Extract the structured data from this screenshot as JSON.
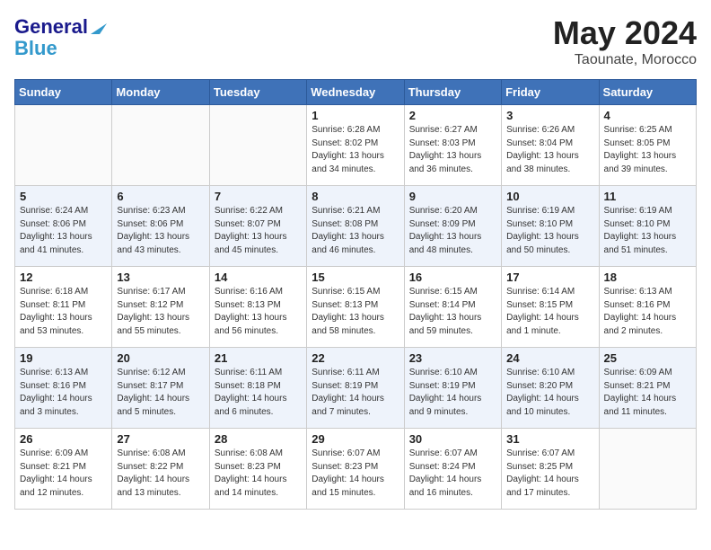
{
  "header": {
    "logo_line1": "General",
    "logo_line2": "Blue",
    "month": "May 2024",
    "location": "Taounate, Morocco"
  },
  "days_of_week": [
    "Sunday",
    "Monday",
    "Tuesday",
    "Wednesday",
    "Thursday",
    "Friday",
    "Saturday"
  ],
  "weeks": [
    [
      {
        "day": null
      },
      {
        "day": null
      },
      {
        "day": null
      },
      {
        "day": "1",
        "sunrise": "6:28 AM",
        "sunset": "8:02 PM",
        "daylight": "13 hours and 34 minutes."
      },
      {
        "day": "2",
        "sunrise": "6:27 AM",
        "sunset": "8:03 PM",
        "daylight": "13 hours and 36 minutes."
      },
      {
        "day": "3",
        "sunrise": "6:26 AM",
        "sunset": "8:04 PM",
        "daylight": "13 hours and 38 minutes."
      },
      {
        "day": "4",
        "sunrise": "6:25 AM",
        "sunset": "8:05 PM",
        "daylight": "13 hours and 39 minutes."
      }
    ],
    [
      {
        "day": "5",
        "sunrise": "6:24 AM",
        "sunset": "8:06 PM",
        "daylight": "13 hours and 41 minutes."
      },
      {
        "day": "6",
        "sunrise": "6:23 AM",
        "sunset": "8:06 PM",
        "daylight": "13 hours and 43 minutes."
      },
      {
        "day": "7",
        "sunrise": "6:22 AM",
        "sunset": "8:07 PM",
        "daylight": "13 hours and 45 minutes."
      },
      {
        "day": "8",
        "sunrise": "6:21 AM",
        "sunset": "8:08 PM",
        "daylight": "13 hours and 46 minutes."
      },
      {
        "day": "9",
        "sunrise": "6:20 AM",
        "sunset": "8:09 PM",
        "daylight": "13 hours and 48 minutes."
      },
      {
        "day": "10",
        "sunrise": "6:19 AM",
        "sunset": "8:10 PM",
        "daylight": "13 hours and 50 minutes."
      },
      {
        "day": "11",
        "sunrise": "6:19 AM",
        "sunset": "8:10 PM",
        "daylight": "13 hours and 51 minutes."
      }
    ],
    [
      {
        "day": "12",
        "sunrise": "6:18 AM",
        "sunset": "8:11 PM",
        "daylight": "13 hours and 53 minutes."
      },
      {
        "day": "13",
        "sunrise": "6:17 AM",
        "sunset": "8:12 PM",
        "daylight": "13 hours and 55 minutes."
      },
      {
        "day": "14",
        "sunrise": "6:16 AM",
        "sunset": "8:13 PM",
        "daylight": "13 hours and 56 minutes."
      },
      {
        "day": "15",
        "sunrise": "6:15 AM",
        "sunset": "8:13 PM",
        "daylight": "13 hours and 58 minutes."
      },
      {
        "day": "16",
        "sunrise": "6:15 AM",
        "sunset": "8:14 PM",
        "daylight": "13 hours and 59 minutes."
      },
      {
        "day": "17",
        "sunrise": "6:14 AM",
        "sunset": "8:15 PM",
        "daylight": "14 hours and 1 minute."
      },
      {
        "day": "18",
        "sunrise": "6:13 AM",
        "sunset": "8:16 PM",
        "daylight": "14 hours and 2 minutes."
      }
    ],
    [
      {
        "day": "19",
        "sunrise": "6:13 AM",
        "sunset": "8:16 PM",
        "daylight": "14 hours and 3 minutes."
      },
      {
        "day": "20",
        "sunrise": "6:12 AM",
        "sunset": "8:17 PM",
        "daylight": "14 hours and 5 minutes."
      },
      {
        "day": "21",
        "sunrise": "6:11 AM",
        "sunset": "8:18 PM",
        "daylight": "14 hours and 6 minutes."
      },
      {
        "day": "22",
        "sunrise": "6:11 AM",
        "sunset": "8:19 PM",
        "daylight": "14 hours and 7 minutes."
      },
      {
        "day": "23",
        "sunrise": "6:10 AM",
        "sunset": "8:19 PM",
        "daylight": "14 hours and 9 minutes."
      },
      {
        "day": "24",
        "sunrise": "6:10 AM",
        "sunset": "8:20 PM",
        "daylight": "14 hours and 10 minutes."
      },
      {
        "day": "25",
        "sunrise": "6:09 AM",
        "sunset": "8:21 PM",
        "daylight": "14 hours and 11 minutes."
      }
    ],
    [
      {
        "day": "26",
        "sunrise": "6:09 AM",
        "sunset": "8:21 PM",
        "daylight": "14 hours and 12 minutes."
      },
      {
        "day": "27",
        "sunrise": "6:08 AM",
        "sunset": "8:22 PM",
        "daylight": "14 hours and 13 minutes."
      },
      {
        "day": "28",
        "sunrise": "6:08 AM",
        "sunset": "8:23 PM",
        "daylight": "14 hours and 14 minutes."
      },
      {
        "day": "29",
        "sunrise": "6:07 AM",
        "sunset": "8:23 PM",
        "daylight": "14 hours and 15 minutes."
      },
      {
        "day": "30",
        "sunrise": "6:07 AM",
        "sunset": "8:24 PM",
        "daylight": "14 hours and 16 minutes."
      },
      {
        "day": "31",
        "sunrise": "6:07 AM",
        "sunset": "8:25 PM",
        "daylight": "14 hours and 17 minutes."
      },
      {
        "day": null
      }
    ]
  ]
}
